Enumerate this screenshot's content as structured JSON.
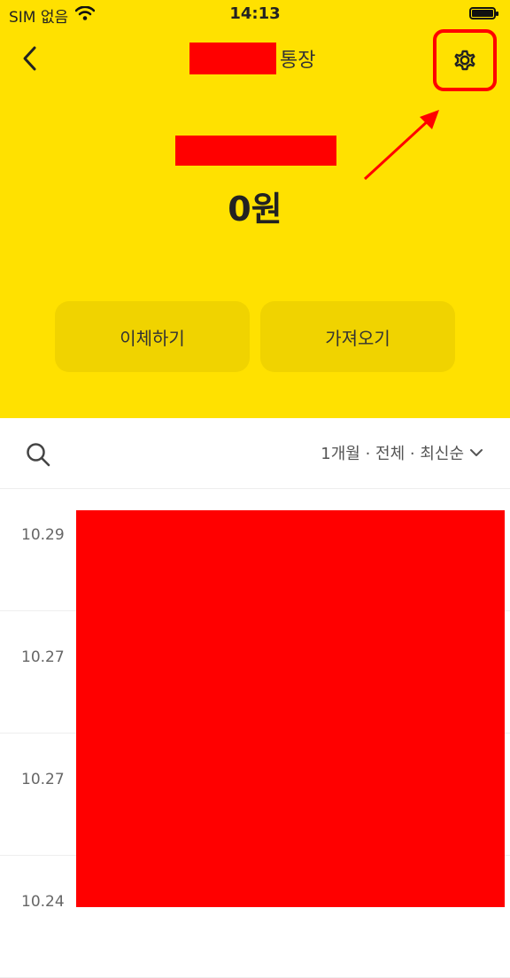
{
  "status_bar": {
    "carrier": "SIM 없음",
    "time": "14:13"
  },
  "nav": {
    "title_suffix": "통장"
  },
  "account": {
    "balance": "0원"
  },
  "actions": {
    "transfer_label": "이체하기",
    "import_label": "가져오기"
  },
  "toolbar": {
    "filter_label": "1개월 · 전체 · 최신순"
  },
  "transactions": [
    {
      "date": "10.29"
    },
    {
      "date": "10.27"
    },
    {
      "date": "10.27"
    },
    {
      "date": "10.24"
    }
  ],
  "colors": {
    "brand_yellow": "#FFE100",
    "button_yellow": "#F0D300",
    "annotation_red": "#FF0000"
  },
  "icons": {
    "back": "chevron-left-icon",
    "settings": "gear-icon",
    "search": "search-icon",
    "filter": "chevron-down-icon",
    "wifi": "wifi-icon",
    "battery": "battery-icon"
  }
}
